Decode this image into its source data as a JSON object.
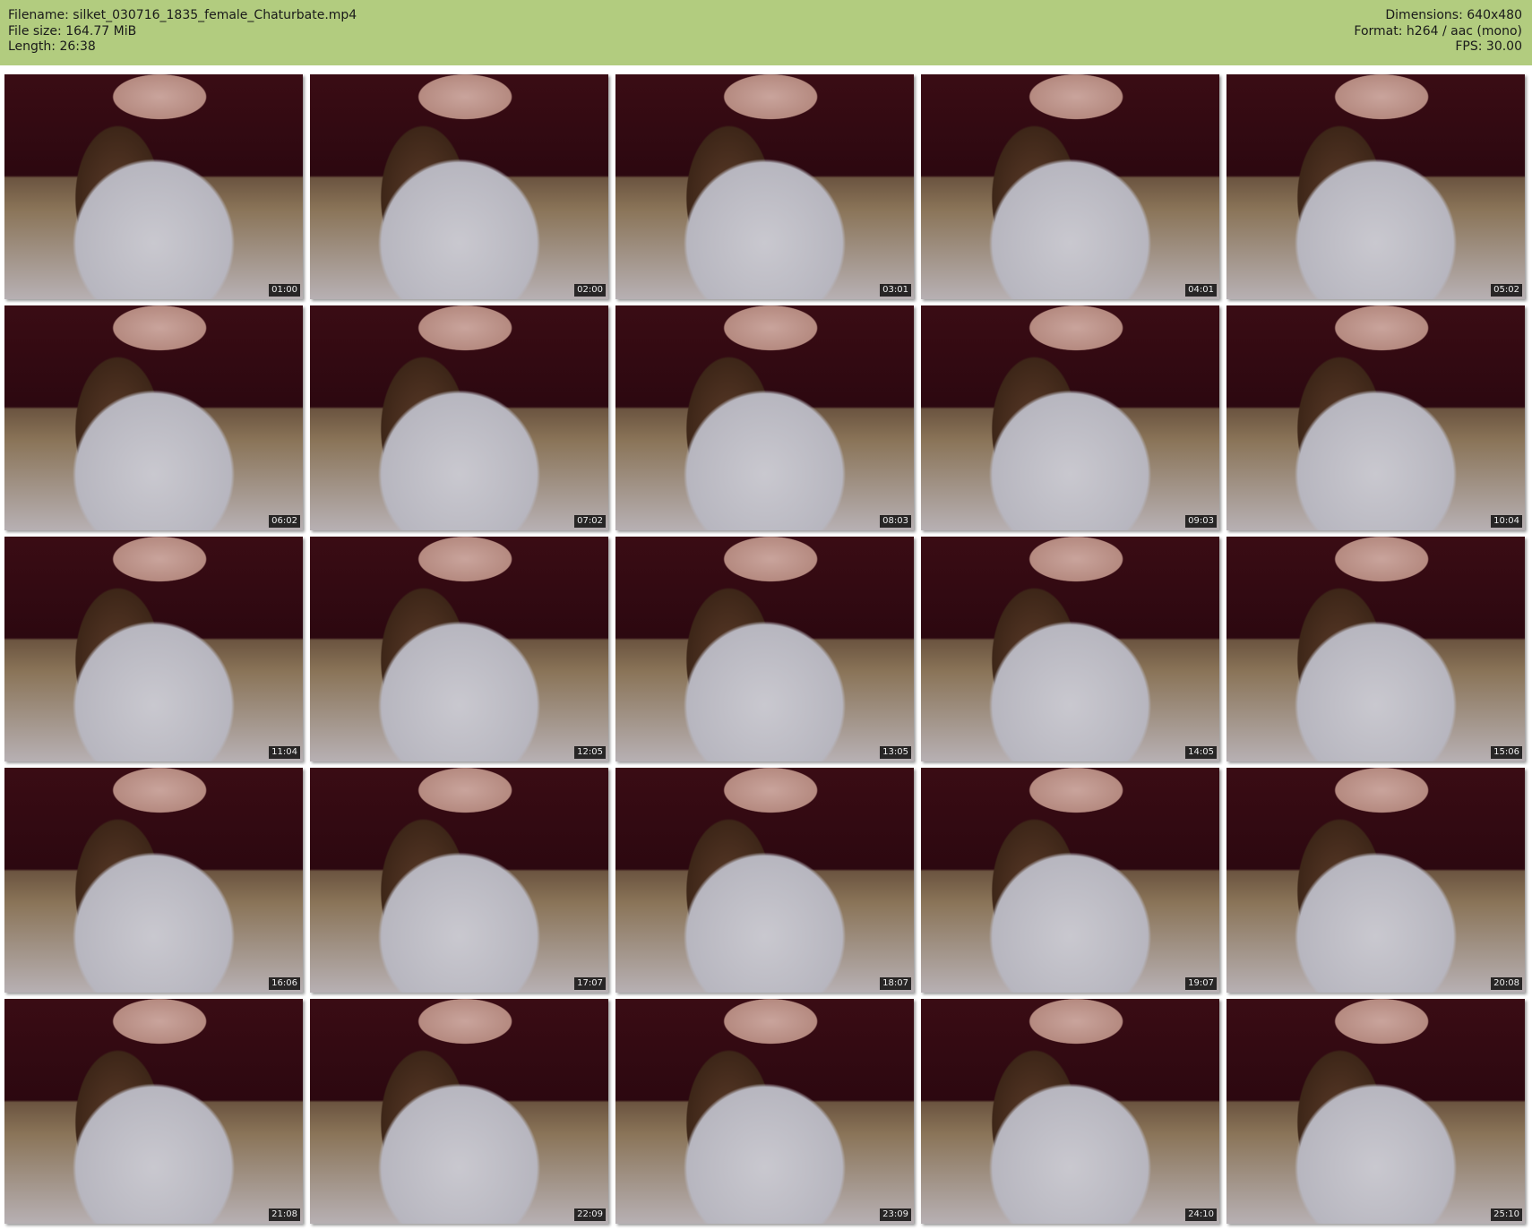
{
  "header": {
    "filename": "Filename: silket_030716_1835_female_Chaturbate.mp4",
    "file_size": "File size: 164.77 MiB",
    "length": "Length: 26:38",
    "dimensions": "Dimensions: 640x480",
    "format": "Format: h264 / aac (mono)",
    "fps": "FPS: 30.00"
  },
  "thumbnails": [
    "01:00",
    "02:00",
    "03:01",
    "04:01",
    "05:02",
    "06:02",
    "07:02",
    "08:03",
    "09:03",
    "10:04",
    "11:04",
    "12:05",
    "13:05",
    "14:05",
    "15:06",
    "16:06",
    "17:07",
    "18:07",
    "19:07",
    "20:08",
    "21:08",
    "22:09",
    "23:09",
    "24:10",
    "25:10"
  ]
}
